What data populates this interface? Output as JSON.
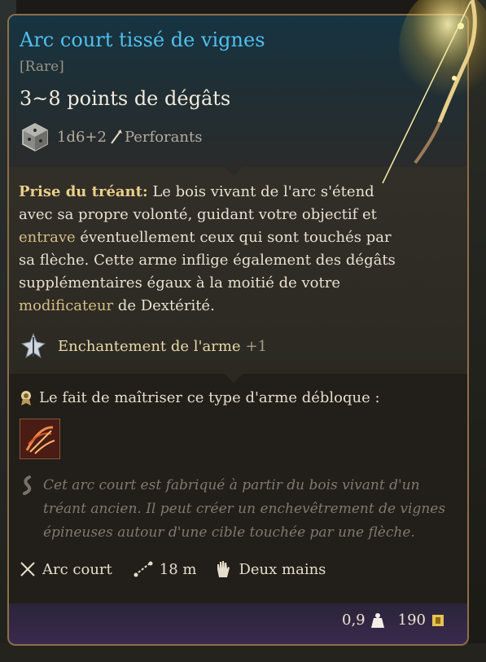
{
  "item": {
    "name": "Arc court tissé de vignes",
    "rarity": "[Rare]",
    "damage": "3~8 points de dégâts",
    "dice": "1d6+2",
    "damage_type": "Perforants"
  },
  "description": {
    "ability_name": "Prise du tréant:",
    "text_1": " Le bois vivant de l'arc s'étend avec sa propre volonté, guidant votre objectif et ",
    "keyword_1": "entrave",
    "text_2": " éventuellement ceux qui sont touchés par sa flèche. Cette arme inflige également des dégâts supplémentaires égaux à la moitié de votre ",
    "keyword_2": "modificateur",
    "text_3": " de Dextérité."
  },
  "enchantment": {
    "label": "Enchantement de l'arme",
    "bonus": "+1"
  },
  "mastery": {
    "label": "Le fait de maîtriser ce type d'arme débloque :"
  },
  "lore": "Cet arc court est fabriqué à partir du bois vivant d'un tréant ancien. Il peut créer un enchevêtrement de vignes épineuses autour d'une cible touchée par une flèche.",
  "stats": {
    "type": "Arc court",
    "range": "18 m",
    "handedness": "Deux mains"
  },
  "footer": {
    "weight": "0,9",
    "value": "190"
  },
  "icons": [
    "dice-icon",
    "arrow-icon",
    "enchantment-icon",
    "mastery-ribbon-icon",
    "bow-skill-icon",
    "lore-scroll-icon",
    "crossed-weapons-icon",
    "range-icon",
    "hand-icon",
    "weight-icon",
    "gold-coin-icon",
    "bow-image"
  ],
  "colors": {
    "title": "#4fc0ef",
    "highlight": "#e9cf8a",
    "border": "#8c6f4c"
  }
}
